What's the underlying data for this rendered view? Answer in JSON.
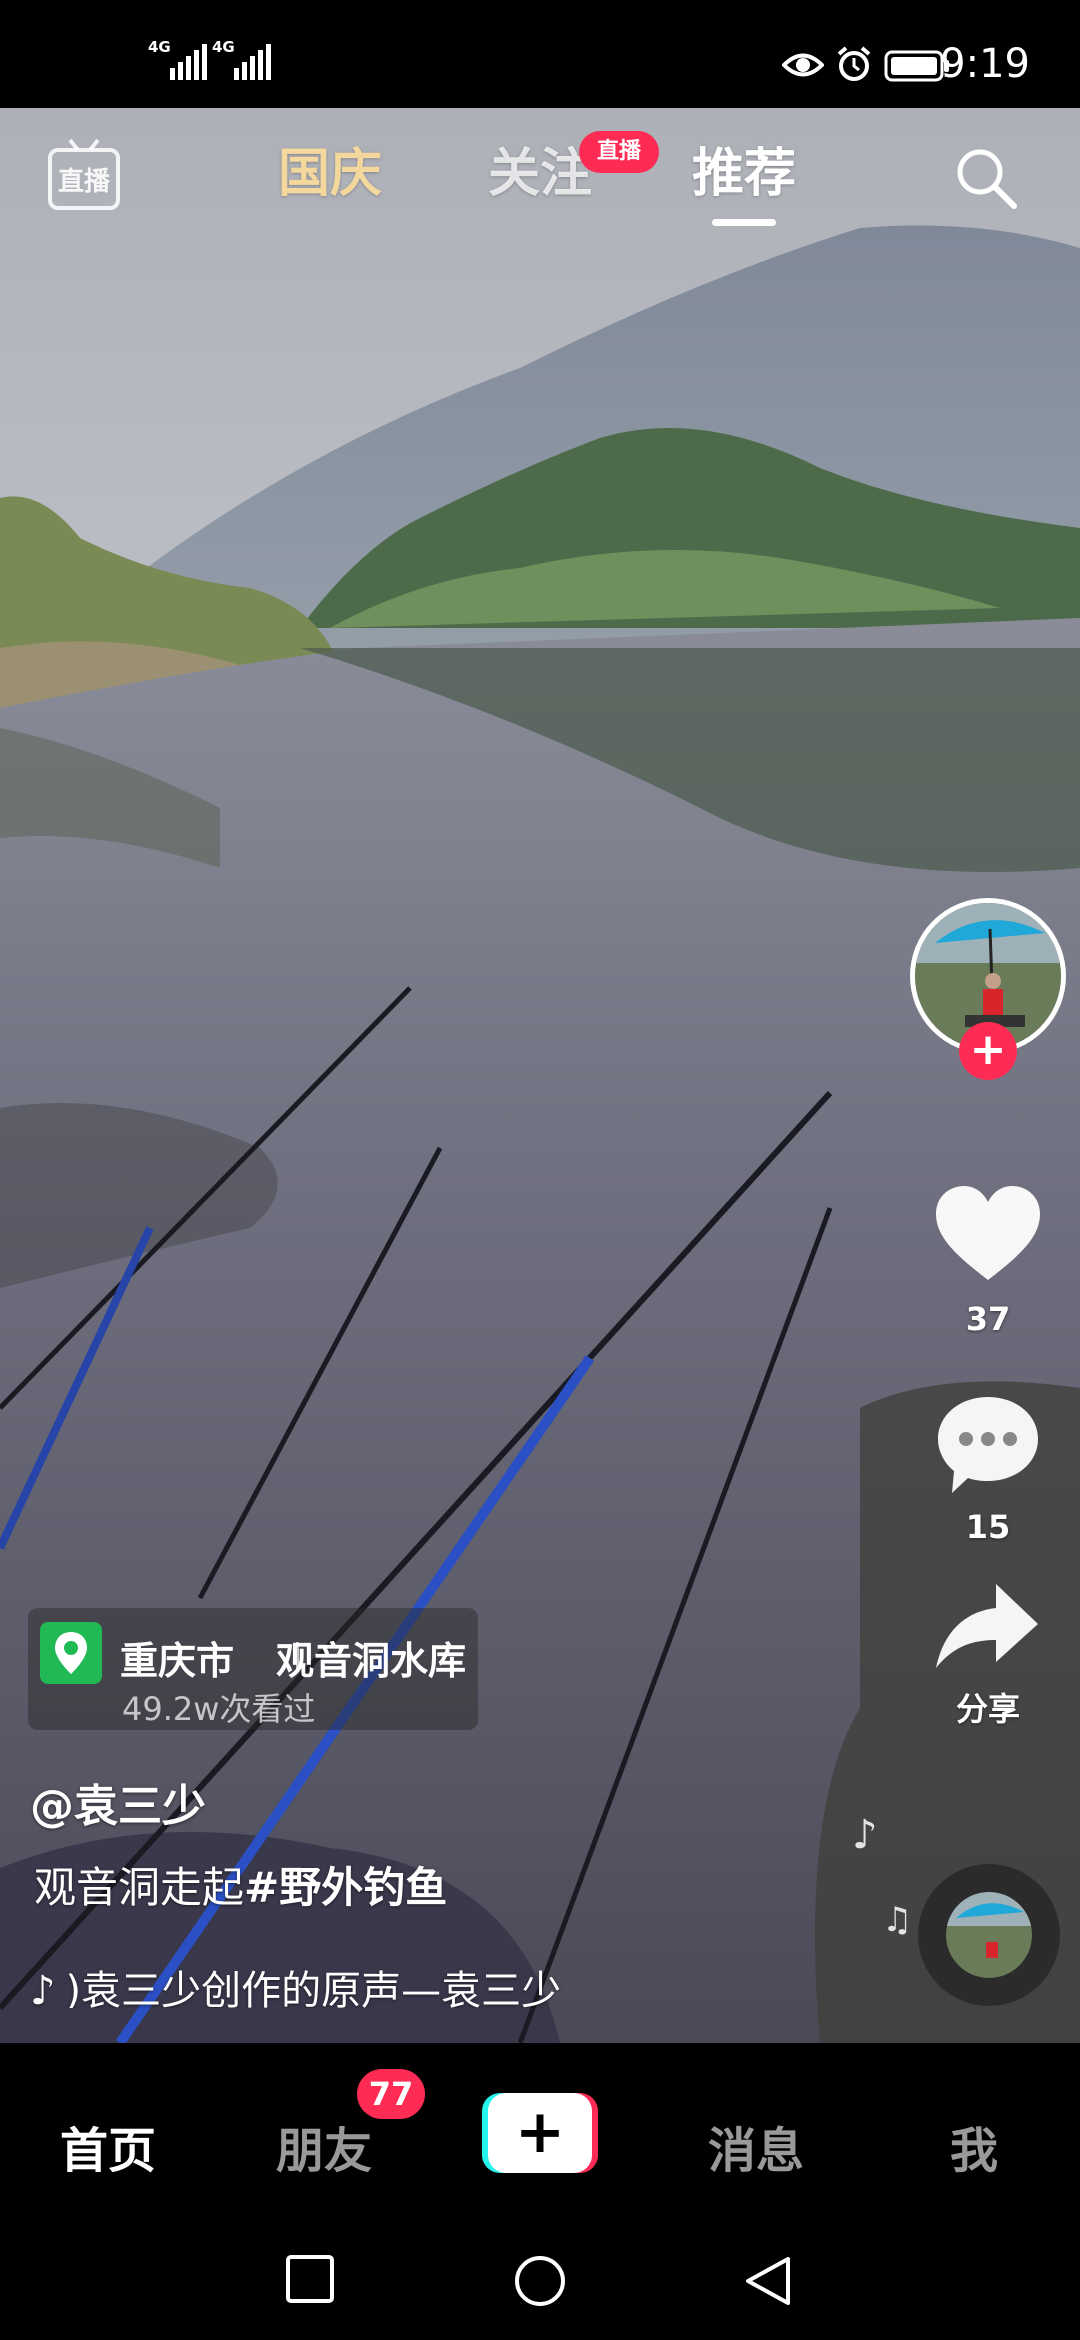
{
  "status_bar": {
    "sim1_label": "4G",
    "sim2_label": "4G",
    "time": "9:19",
    "icons": [
      "eye-icon",
      "alarm-icon",
      "battery-icon"
    ]
  },
  "top_nav": {
    "live_icon_label": "直播",
    "tabs": [
      {
        "label": "国庆"
      },
      {
        "label": "关注"
      },
      {
        "label": "推荐"
      }
    ],
    "live_badge": "直播",
    "search_icon": "search-icon"
  },
  "right_rail": {
    "likes": "37",
    "comments": "15",
    "share_label": "分享",
    "follow_label": "+"
  },
  "location": {
    "city": "重庆市",
    "place": "观音洞水库",
    "views": "49.2w次看过"
  },
  "post": {
    "author": "@袁三少",
    "caption_text": "观音洞走起",
    "caption_tag": "#野外钓鱼",
    "music_text": ")袁三少创作的原声—袁三少"
  },
  "bottom_tabs": {
    "home": "首页",
    "friends": "朋友",
    "friends_badge": "77",
    "create": "+",
    "messages": "消息",
    "me": "我"
  },
  "system_nav": [
    "recents-square-icon",
    "home-circle-icon",
    "back-triangle-icon"
  ],
  "colors": {
    "accent_red": "#fe2c55",
    "accent_cyan": "#25f4ee",
    "location_green": "#20b954",
    "tab_gold": "#f3d79c"
  }
}
